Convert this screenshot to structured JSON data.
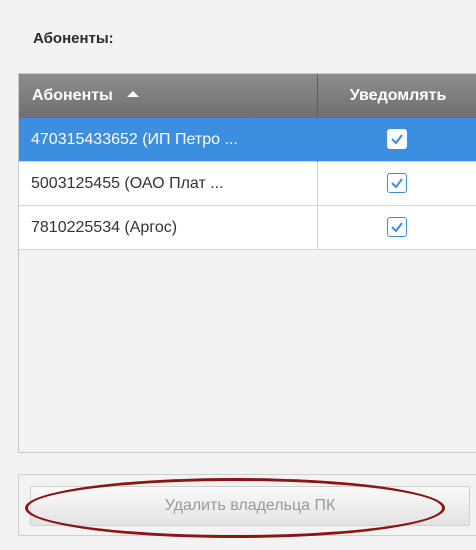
{
  "section": {
    "title": "Абоненты:"
  },
  "table": {
    "columns": {
      "name": "Абоненты",
      "notify": "Уведомлять"
    },
    "rows": [
      {
        "name": "470315433652 (ИП Петро ...",
        "notify": true,
        "selected": true
      },
      {
        "name": "5003125455 (ОАО Плат ...",
        "notify": true,
        "selected": false
      },
      {
        "name": "7810225534 (Аргос)",
        "notify": true,
        "selected": false
      }
    ]
  },
  "actions": {
    "delete_label": "Удалить владельца ПК"
  },
  "colors": {
    "header": "#7d7d7d",
    "selected_row": "#3c8ee0",
    "checkbox_border": "#3d8ddc",
    "highlight_ellipse": "#8b1515"
  }
}
